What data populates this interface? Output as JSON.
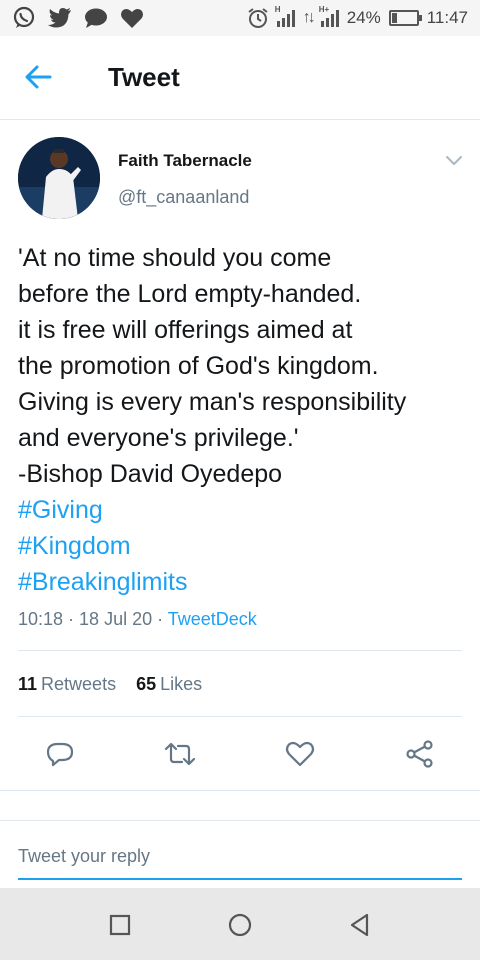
{
  "status_bar": {
    "icons": [
      "whatsapp-icon",
      "twitter-icon",
      "chat-bubble-icon",
      "heart-icon"
    ],
    "battery_percent": "24%",
    "battery_level": 0.24,
    "time": "11:47"
  },
  "header": {
    "back_icon": "arrow-left-icon",
    "title": "Tweet"
  },
  "tweet": {
    "author_name": "Faith Tabernacle",
    "author_handle": "@ft_canaanland",
    "text_lines": [
      "'At no time should you come",
      "before the Lord empty-handed.",
      "it is free will offerings aimed at",
      "the promotion of God's kingdom.",
      "Giving is every man's responsibility",
      "and everyone's privilege.'",
      "-Bishop David Oyedepo"
    ],
    "hashtags": [
      "#Giving",
      "#Kingdom",
      "#Breakinglimits"
    ],
    "timestamp": "10:18 · 18 Jul 20 · ",
    "source": "TweetDeck",
    "retweets_count": "11",
    "retweets_label": "Retweets",
    "likes_count": "65",
    "likes_label": "Likes"
  },
  "actions": [
    "reply-icon",
    "retweet-icon",
    "like-icon",
    "share-icon"
  ],
  "reply": {
    "placeholder": "Tweet your reply"
  },
  "colors": {
    "accent": "#1da1f2",
    "secondary_text": "#657786",
    "divider": "#e1e8ed"
  }
}
